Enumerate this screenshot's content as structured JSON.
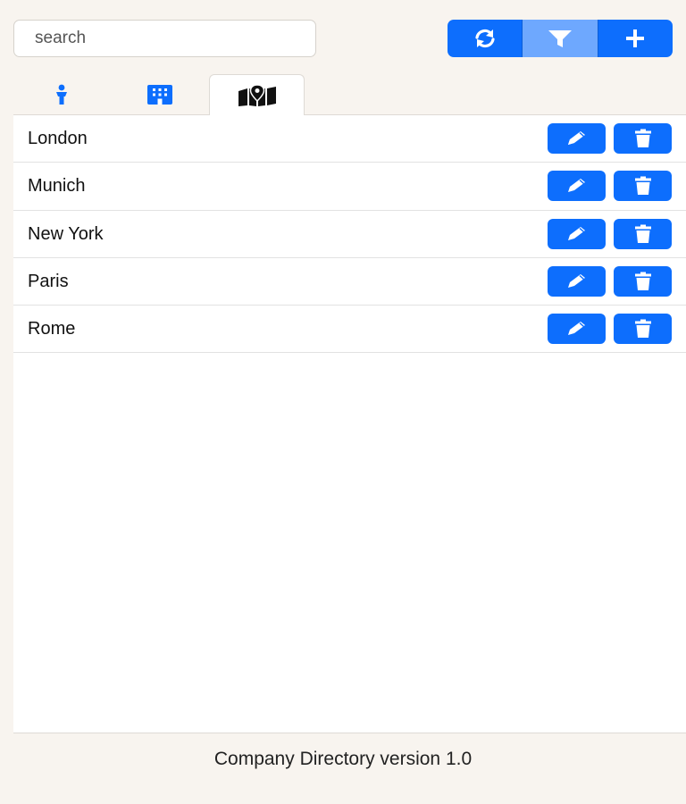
{
  "search": {
    "placeholder": "search",
    "value": ""
  },
  "toolbar": {
    "refresh_icon": "refresh-icon",
    "filter_icon": "filter-icon",
    "add_icon": "plus-icon",
    "active": "filter"
  },
  "tabs": [
    {
      "icon": "person-icon",
      "active": false
    },
    {
      "icon": "building-icon",
      "active": false
    },
    {
      "icon": "map-location-icon",
      "active": true
    }
  ],
  "locations": [
    {
      "name": "London"
    },
    {
      "name": "Munich"
    },
    {
      "name": "New York"
    },
    {
      "name": "Paris"
    },
    {
      "name": "Rome"
    }
  ],
  "row_actions": {
    "edit_icon": "pencil-icon",
    "delete_icon": "trash-icon"
  },
  "footer": {
    "text": "Company Directory version 1.0"
  },
  "colors": {
    "primary": "#0d6efd",
    "primary_active": "#6ea8fe",
    "background": "#f8f4ef"
  }
}
